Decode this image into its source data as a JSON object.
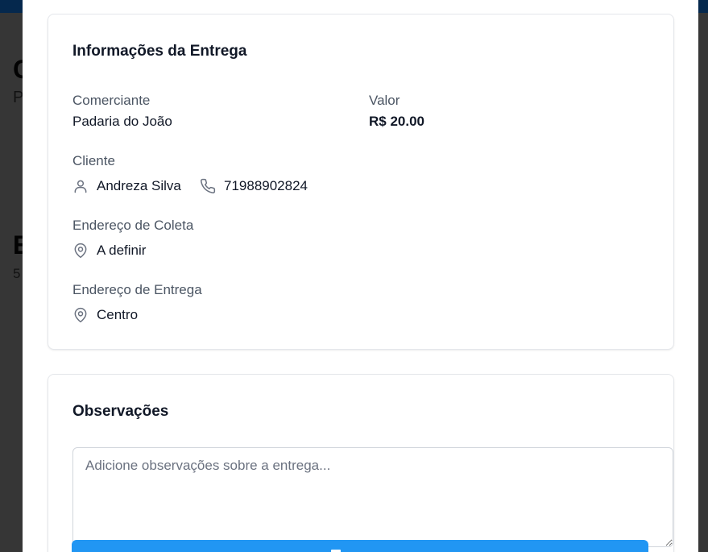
{
  "background": {
    "letters": [
      "C",
      "P",
      "E",
      "5"
    ]
  },
  "delivery_info": {
    "title": "Informações da Entrega",
    "merchant_label": "Comerciante",
    "merchant_value": "Padaria do João",
    "amount_label": "Valor",
    "amount_value": "R$ 20.00",
    "client_label": "Cliente",
    "client_name": "Andreza Silva",
    "client_phone": "71988902824",
    "pickup_label": "Endereço de Coleta",
    "pickup_value": "A definir",
    "dropoff_label": "Endereço de Entrega",
    "dropoff_value": "Centro"
  },
  "observations": {
    "title": "Observações",
    "placeholder": "Adicione observações sobre a entrega...",
    "value": ""
  },
  "colors": {
    "accent": "#2196f3",
    "topbar": "#0a4a8c"
  },
  "icons": {
    "client": "user-icon",
    "phone": "phone-icon",
    "pickup": "map-pin-icon",
    "dropoff": "map-pin-icon"
  }
}
